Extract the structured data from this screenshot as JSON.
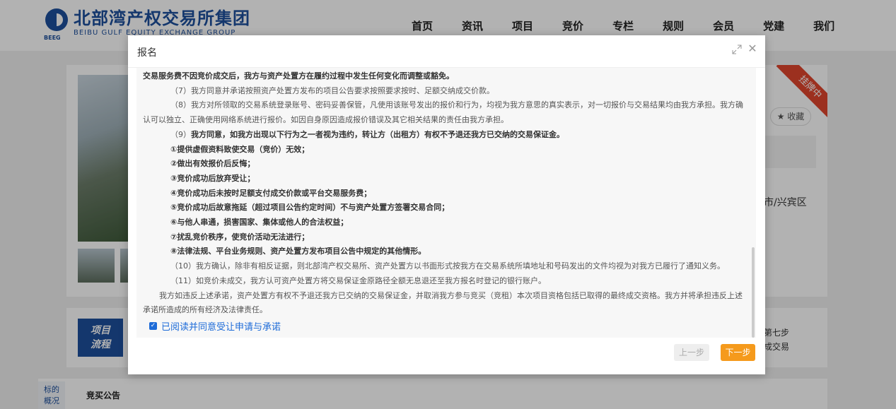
{
  "header": {
    "logo_cn": "北部湾产权交易所集团",
    "logo_en": "BEIBU GULF EQUITY EXCHANGE GROUP",
    "logo_abbr": "BEEG",
    "nav": [
      "首页",
      "资讯",
      "项目",
      "竞价",
      "专栏",
      "规则",
      "会员",
      "党建",
      "我们"
    ]
  },
  "background": {
    "badge": "挂牌中",
    "collect_label": "收藏",
    "location": "市/兴宾区",
    "flow_label_1": "项目",
    "flow_label_2": "流程",
    "step7": "第七步",
    "deal": "成交易",
    "side_tab_1": "标的",
    "side_tab_2": "概况",
    "bid_tab": "竞买公告"
  },
  "modal": {
    "title": "报名",
    "lines": [
      "交易服务费不因竞价成交后，我方与资产处置方在履约过程中发生任何变化而调整或豁免。",
      "（7）我方同意并承诺按照资产处置方发布的项目公告要求按照要求按时、足额交纳成交价款。",
      "（8）我方对所领取的交易系统登录账号、密码妥善保管，凡使用该账号发出的报价和行为，均视为我方意思的真实表示，对一切报价与交易结果均由我方承担。我方确",
      "认可以独立、正确使用网络系统进行报价。如因自身原因造成报价错误及其它相关结果的责任由我方承担。",
      "（9）",
      "我方同意，如我方出现以下行为之一者视为违约，转让方（出租方）有权不予退还我方已交纳的交易保证金。",
      "①提供虚假资料致使交易（竞价）无效；",
      "②做出有效报价后反悔；",
      "③竞价成功后放弃受让；",
      "④竞价成功后未按时足额支付成交价款或平台交易服务费；",
      "⑤竞价成功后故意拖延（超过项目公告约定时间）不与资产处置方签署交易合同；",
      "⑥与他人串通，损害国家、集体或他人的合法权益；",
      "⑦扰乱竞价秩序，使竞价活动无法进行；",
      "⑧法律法规、平台业务规则、资产处置方发布项目公告中规定的其他情形。",
      "（10）我方确认，除非有相反证据，则北部湾产权交易所、资产处置方以书面形式按我方在交易系统所填地址和号码发出的文件均视为对我方已履行了通知义务。",
      "（11）如竞价未成交，我方认可资产处置方将交易保证金原路径全额无息退还至我方报名时登记的银行账户。",
      "我方如违反上述承诺，资产处置方有权不予退还我方已交纳的交易保证金，并取消我方参与竞买（竞租）本次项目资格包括已取得的最终成交资格。我方并将承担违反上述",
      "承诺所造成的所有经济及法律责任。"
    ],
    "agree_label": "已阅读并同意受让申请与承诺",
    "prev_label": "上一步",
    "next_label": "下一步"
  }
}
